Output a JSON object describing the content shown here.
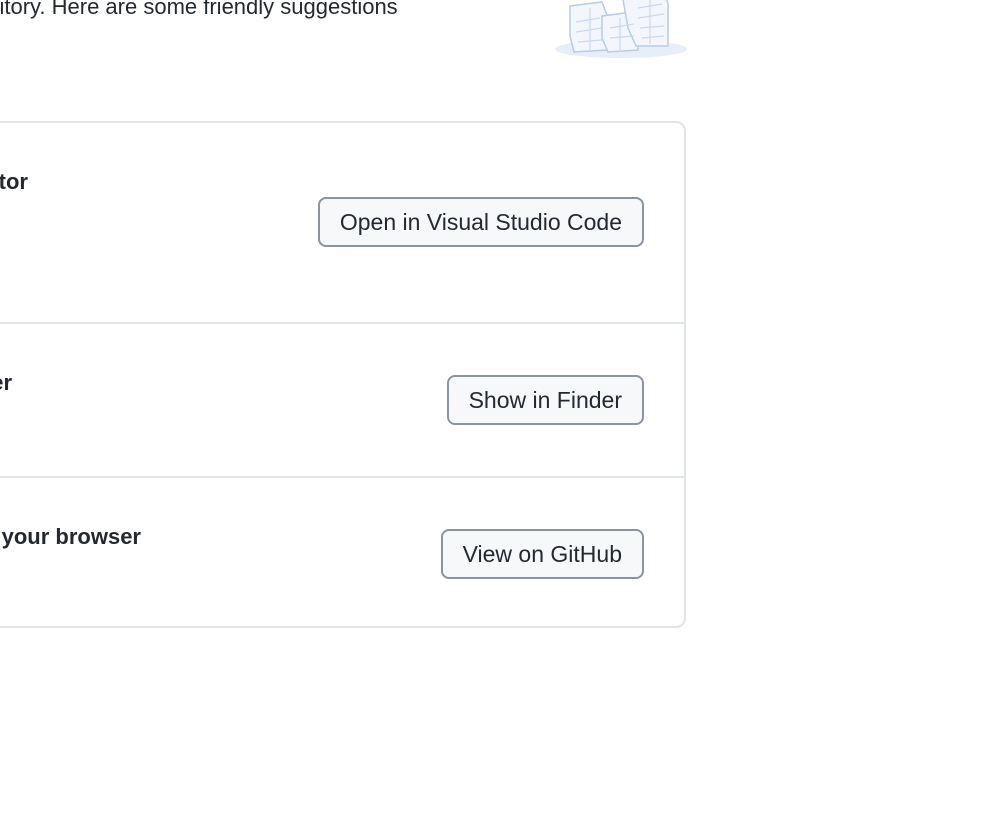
{
  "intro": {
    "text": "pository. Here are some friendly suggestions"
  },
  "illustration": {
    "icon": "empty-repository-boxes-illustration",
    "color": "#dbe6f6"
  },
  "suggestions": [
    {
      "title": "tor",
      "button_label": "Open in Visual Studio Code"
    },
    {
      "title": "er",
      "button_label": "Show in Finder"
    },
    {
      "title": "your browser",
      "button_label": "View on GitHub"
    }
  ],
  "colors": {
    "border": "#e1e4e8",
    "button_border": "#8b949e",
    "button_bg": "#f6f8fa",
    "text": "#24292f"
  }
}
